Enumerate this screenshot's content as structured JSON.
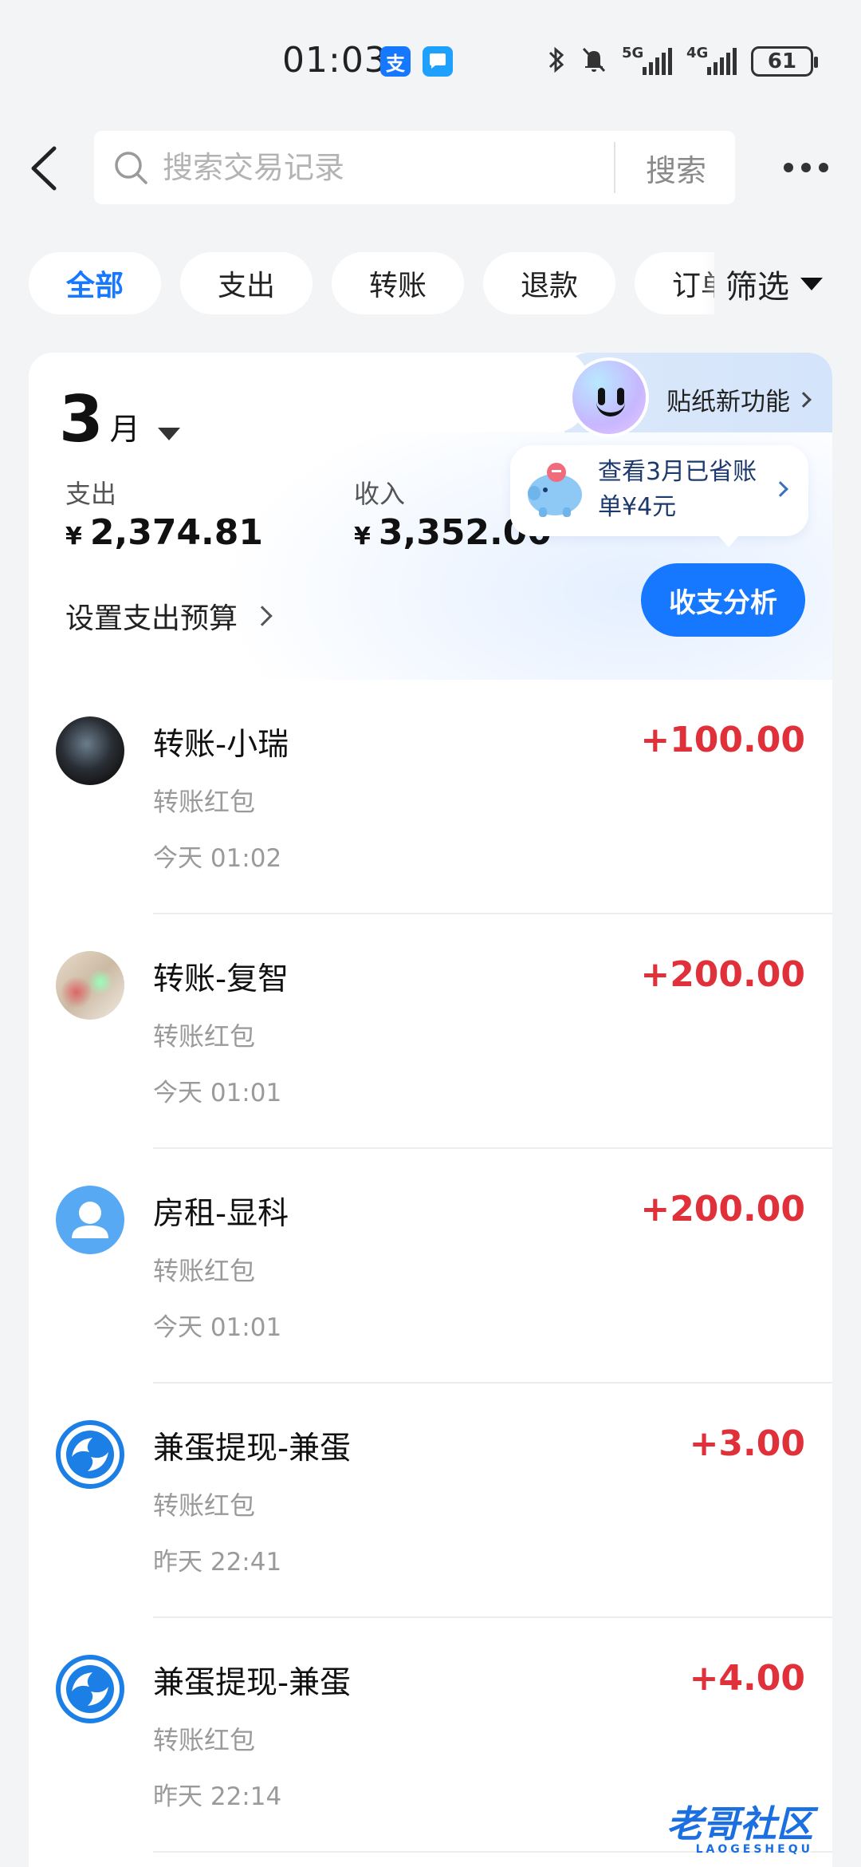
{
  "status_bar": {
    "time": "01:03",
    "app_icon_1": "支",
    "battery": "61",
    "network_1": "5G",
    "network_2": "4G",
    "icons": [
      "alipay-icon",
      "message-icon",
      "bluetooth-icon",
      "mute-bell-icon",
      "signal-icon",
      "battery-icon"
    ]
  },
  "header": {
    "search_placeholder": "搜索交易记录",
    "search_button": "搜索"
  },
  "filters": {
    "chips": [
      "全部",
      "支出",
      "转账",
      "退款",
      "订单"
    ],
    "active_index": 0,
    "filter_label": "筛选"
  },
  "summary": {
    "month_number": "3",
    "month_unit": "月",
    "sticker_label": "贴纸新功能",
    "expense_label": "支出",
    "expense_value": "2,374.81",
    "income_label": "收入",
    "income_value": "3,352.00",
    "currency": "¥",
    "budget_link": "设置支出预算",
    "save_bubble_text": "查看3月已省账单¥4元",
    "analysis_button": "收支分析"
  },
  "transactions": [
    {
      "title": "转账-小瑞",
      "subtitle": "转账红包",
      "time": "今天 01:02",
      "amount": "+100.00",
      "avatar": "photo-avatar"
    },
    {
      "title": "转账-复智",
      "subtitle": "转账红包",
      "time": "今天 01:01",
      "amount": "+200.00",
      "avatar": "photo-avatar"
    },
    {
      "title": "房租-显科",
      "subtitle": "转账红包",
      "time": "今天 01:01",
      "amount": "+200.00",
      "avatar": "default-user-avatar"
    },
    {
      "title": "兼蛋提现-兼蛋",
      "subtitle": "转账红包",
      "time": "昨天 22:41",
      "amount": "+3.00",
      "avatar": "brand-logo-avatar"
    },
    {
      "title": "兼蛋提现-兼蛋",
      "subtitle": "转账红包",
      "time": "昨天 22:14",
      "amount": "+4.00",
      "avatar": "brand-logo-avatar"
    }
  ],
  "watermark": {
    "text": "老哥社区",
    "subtext": "LAOGESHEQU"
  },
  "colors": {
    "accent": "#1677ff",
    "income": "#e0303a",
    "background": "#f3f4f6"
  }
}
